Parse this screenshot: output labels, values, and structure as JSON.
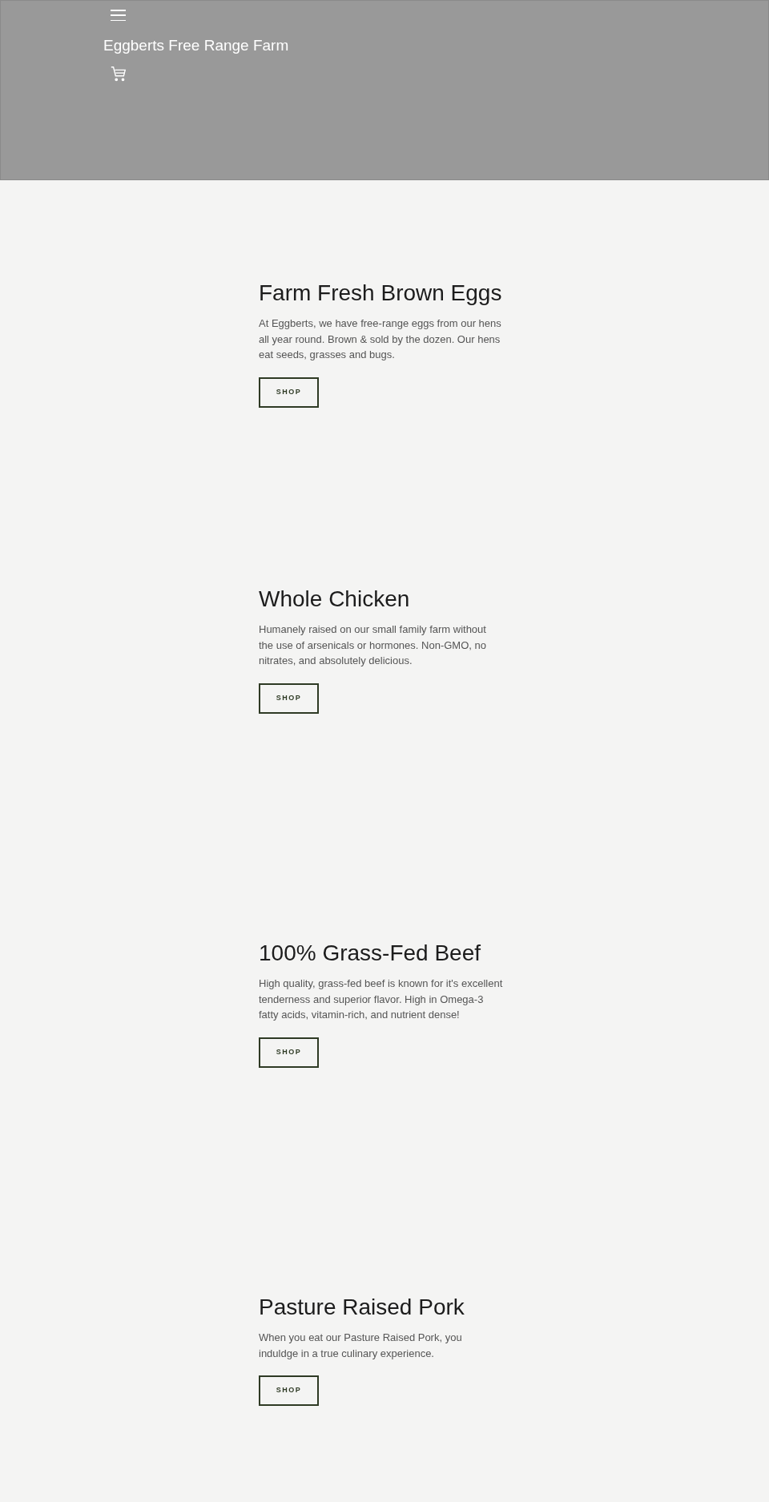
{
  "header": {
    "title": "Eggberts Free Range Farm"
  },
  "sections": [
    {
      "heading": "Farm Fresh Brown Eggs",
      "text": "At Eggberts, we have free-range eggs from our hens all year round. Brown & sold by the dozen. Our hens eat seeds, grasses and bugs.",
      "button": "SHOP"
    },
    {
      "heading": "Whole Chicken",
      "text": "Humanely raised on our small family farm without the use of arsenicals or hormones. Non-GMO, no nitrates, and absolutely delicious.",
      "button": "SHOP"
    },
    {
      "heading": "100% Grass-Fed Beef",
      "text": "High quality, grass-fed beef is known for it's excellent tenderness and superior flavor. High in Omega-3 fatty acids, vitamin-rich, and nutrient dense!",
      "button": "SHOP"
    },
    {
      "heading": "Pasture Raised Pork",
      "text": "When you eat our Pasture Raised Pork, you induldge in a true culinary experience.",
      "button": "SHOP"
    }
  ]
}
